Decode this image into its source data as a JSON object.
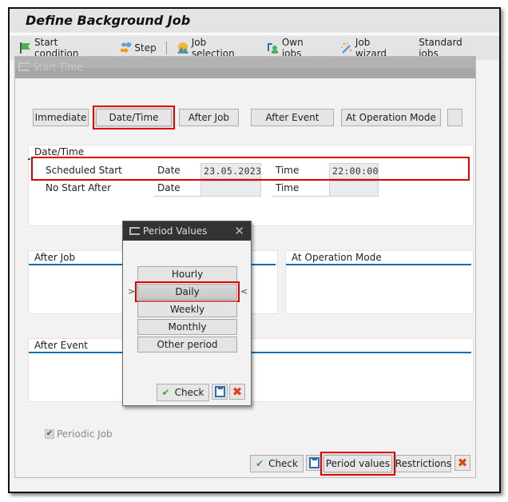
{
  "window": {
    "title": "Define Background Job"
  },
  "toolbar": {
    "items": [
      {
        "label": "Start condition",
        "icon": "flag-icon"
      },
      {
        "label": "Step",
        "icon": "step-icon"
      },
      {
        "label": "Job selection",
        "icon": "mountain-icon"
      },
      {
        "label": "Own jobs",
        "icon": "user-icon"
      },
      {
        "label": "Job wizard",
        "icon": "magic-wand-icon"
      },
      {
        "label": "Standard jobs",
        "icon": null
      }
    ]
  },
  "start_time_dialog": {
    "title": "Start Time",
    "tabs": {
      "immediate": "Immediate",
      "date_time": "Date/Time",
      "after_job": "After Job",
      "after_event": "After Event",
      "at_operation_mode": "At Operation Mode",
      "more": ""
    },
    "date_time_group": {
      "title": "Date/Time",
      "scheduled_start": {
        "label": "Scheduled Start",
        "date_label": "Date",
        "date_value": "23.05.2023",
        "time_label": "Time",
        "time_value": "22:00:00"
      },
      "no_start_after": {
        "label": "No Start After",
        "date_label": "Date",
        "date_value": "",
        "time_label": "Time",
        "time_value": ""
      }
    },
    "after_job_group": {
      "title": "After Job"
    },
    "at_operation_mode_group": {
      "title": "At Operation Mode"
    },
    "after_event_group": {
      "title": "After Event"
    },
    "periodic_job": {
      "label": "Periodic Job",
      "checked": true
    },
    "footer": {
      "check": "Check",
      "period_values": "Period values",
      "restrictions": "Restrictions"
    }
  },
  "period_values_dialog": {
    "title": "Period Values",
    "options": [
      "Hourly",
      "Daily",
      "Weekly",
      "Monthly",
      "Other period"
    ],
    "selected": "Daily",
    "check": "Check"
  },
  "colors": {
    "highlight": "#e00000",
    "group_line": "#0a6eb4",
    "check_green": "#3aa63a",
    "cancel_red": "#e0401a"
  }
}
